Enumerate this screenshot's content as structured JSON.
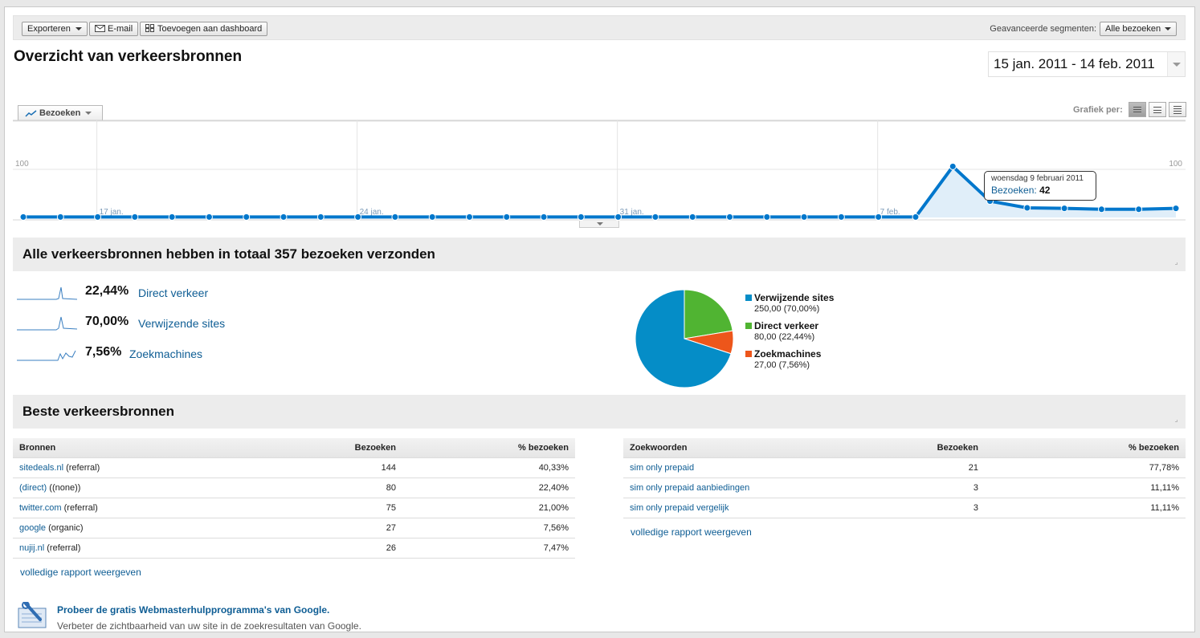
{
  "toolbar": {
    "export_label": "Exporteren",
    "email_label": "E-mail",
    "dashboard_label": "Toevoegen aan dashboard",
    "segments_label": "Geavanceerde segmenten:",
    "segments_value": "Alle bezoeken"
  },
  "page_title": "Overzicht van verkeersbronnen",
  "date_range": "15 jan. 2011 - 14 feb. 2011",
  "chart_controls": {
    "metric_label": "Bezoeken",
    "grafiek_per_label": "Grafiek per:"
  },
  "chart_data": {
    "type": "area",
    "ylim": [
      0,
      200
    ],
    "yticks": [
      100,
      200
    ],
    "x_tick_labels": [
      "17 jan.",
      "24 jan.",
      "31 jan.",
      "7 feb."
    ],
    "values": [
      1,
      1,
      1,
      1,
      1,
      1,
      1,
      1,
      1,
      1,
      1,
      1,
      1,
      1,
      1,
      1,
      1,
      1,
      1,
      1,
      1,
      1,
      1,
      1,
      1,
      106,
      34,
      20,
      19,
      17,
      17,
      19
    ],
    "color": "#0077cc"
  },
  "tooltip": {
    "date": "woensdag 9 februari 2011",
    "label": "Bezoeken:",
    "value": "42"
  },
  "summary": {
    "heading": "Alle verkeersbronnen hebben in totaal 357 bezoeken verzonden",
    "rows": [
      {
        "pct": "22,44%",
        "name": "Direct verkeer"
      },
      {
        "pct": "70,00%",
        "name": "Verwijzende sites"
      },
      {
        "pct": "7,56%",
        "name": "Zoekmachines"
      }
    ]
  },
  "pie": {
    "slices": [
      {
        "name": "Verwijzende sites",
        "value": 250,
        "label": "250,00 (70,00%)",
        "color": "#058dc7"
      },
      {
        "name": "Direct verkeer",
        "value": 80,
        "label": "80,00 (22,44%)",
        "color": "#50b432"
      },
      {
        "name": "Zoekmachines",
        "value": 27,
        "label": "27,00 (7,56%)",
        "color": "#ed561b"
      }
    ]
  },
  "best": {
    "heading": "Beste verkeersbronnen",
    "sources": {
      "headers": [
        "Bronnen",
        "Bezoeken",
        "% bezoeken"
      ],
      "rows": [
        {
          "link": "sitedeals.nl",
          "type": "(referral)",
          "visits": "144",
          "pct": "40,33%"
        },
        {
          "link": "(direct)",
          "type": "((none))",
          "visits": "80",
          "pct": "22,40%"
        },
        {
          "link": "twitter.com",
          "type": "(referral)",
          "visits": "75",
          "pct": "21,00%"
        },
        {
          "link": "google",
          "type": "(organic)",
          "visits": "27",
          "pct": "7,56%"
        },
        {
          "link": "nujij.nl",
          "type": "(referral)",
          "visits": "26",
          "pct": "7,47%"
        }
      ]
    },
    "keywords": {
      "headers": [
        "Zoekwoorden",
        "Bezoeken",
        "% bezoeken"
      ],
      "rows": [
        {
          "link": "sim only prepaid",
          "visits": "21",
          "pct": "77,78%"
        },
        {
          "link": "sim only prepaid aanbiedingen",
          "visits": "3",
          "pct": "11,11%"
        },
        {
          "link": "sim only prepaid vergelijk",
          "visits": "3",
          "pct": "11,11%"
        }
      ]
    },
    "full_report_label": "volledige rapport weergeven"
  },
  "webmaster": {
    "title": "Probeer de gratis Webmasterhulpprogramma's van Google.",
    "description": "Verbeter de zichtbaarheid van uw site in de zoekresultaten van Google."
  }
}
